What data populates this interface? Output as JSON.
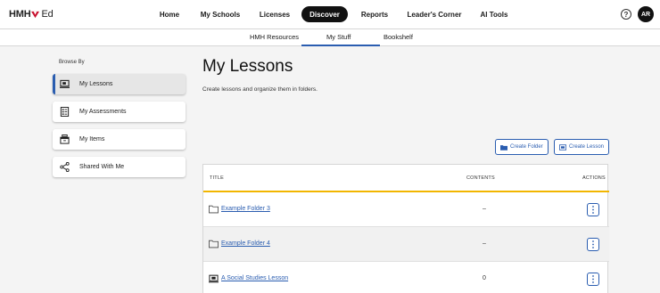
{
  "brand": {
    "logo_text": "HMH",
    "logo_suffix": "Ed",
    "accent": "#c8102e"
  },
  "top_nav": {
    "items": [
      "Home",
      "My Schools",
      "Licenses",
      "Discover",
      "Reports",
      "Leader's Corner",
      "AI Tools"
    ],
    "active": "Discover",
    "help_symbol": "?",
    "avatar_initials": "AR"
  },
  "sub_nav": {
    "items": [
      "HMH Resources",
      "My Stuff",
      "Bookshelf"
    ],
    "active": "My Stuff",
    "accent": "#2a5db0"
  },
  "sidebar": {
    "heading": "Browse By",
    "items": [
      {
        "label": "My Lessons",
        "icon": "lesson-monitor-icon",
        "active": true
      },
      {
        "label": "My Assessments",
        "icon": "assessment-checklist-icon",
        "active": false
      },
      {
        "label": "My Items",
        "icon": "items-tray-icon",
        "active": false
      },
      {
        "label": "Shared With Me",
        "icon": "share-icon",
        "active": false
      }
    ]
  },
  "main": {
    "title": "My Lessons",
    "subtitle": "Create lessons and organize them in folders.",
    "buttons": {
      "create_folder": {
        "label": "Create Folder",
        "icon": "folder-icon"
      },
      "create_lesson": {
        "label": "Create Lesson",
        "icon": "lesson-icon"
      }
    },
    "table": {
      "columns": [
        "TITLE",
        "CONTENTS",
        "ACTIONS"
      ],
      "header_accent": "#f2b600",
      "rows": [
        {
          "title": "Example Folder 3",
          "contents": "–",
          "type_icon": "folder-outline-icon"
        },
        {
          "title": "Example Folder 4",
          "contents": "–",
          "type_icon": "folder-outline-icon"
        },
        {
          "title": "A Social Studies Lesson",
          "contents": "0",
          "type_icon": "lesson-monitor-icon"
        }
      ]
    }
  }
}
